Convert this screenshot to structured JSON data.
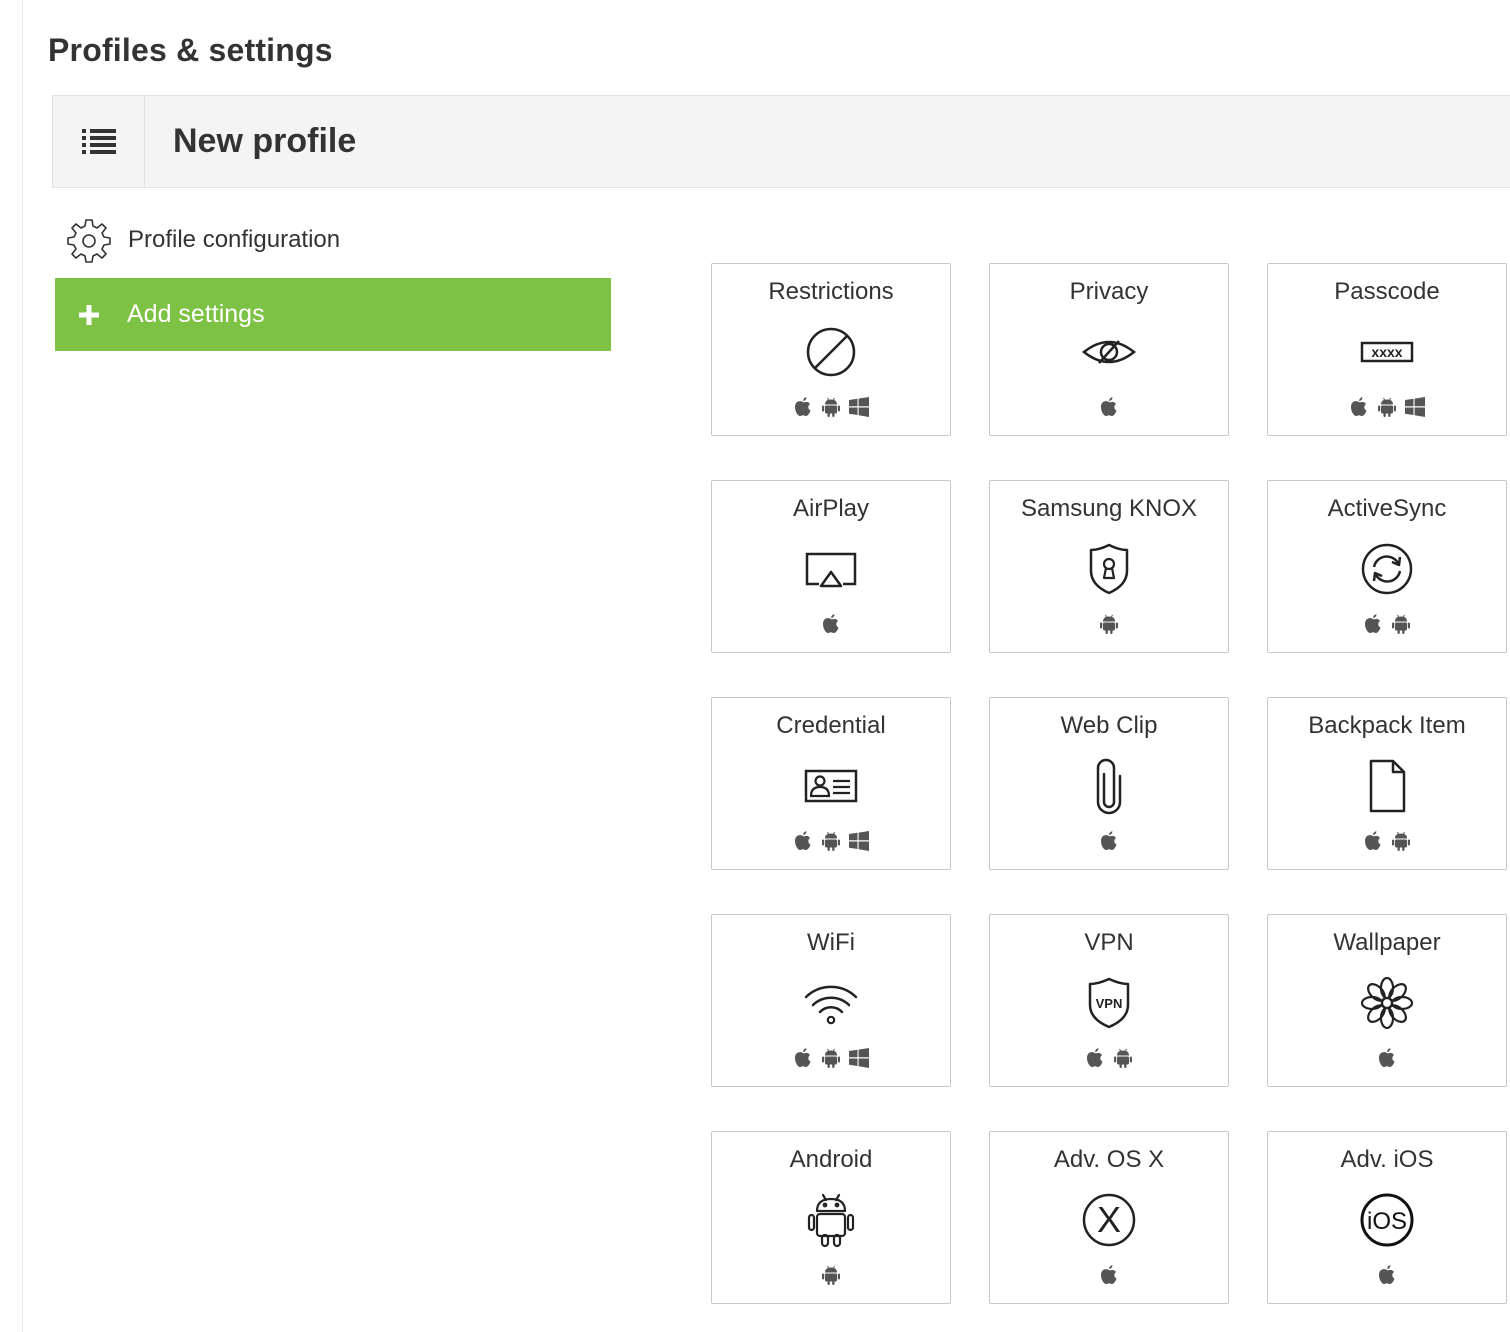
{
  "page": {
    "title": "Profiles & settings",
    "menu_icon": "list-icon"
  },
  "profile": {
    "name": "New profile"
  },
  "sidebar": {
    "config_label": "Profile configuration",
    "config_icon": "gear-icon",
    "add_label": "Add settings",
    "add_icon": "plus-icon",
    "add_color": "#7dc244"
  },
  "tiles": [
    {
      "id": "restrictions",
      "label": "Restrictions",
      "icon": "no-entry-icon",
      "platforms": [
        "apple",
        "android",
        "windows"
      ]
    },
    {
      "id": "privacy",
      "label": "Privacy",
      "icon": "eye-slash-icon",
      "platforms": [
        "apple"
      ]
    },
    {
      "id": "passcode",
      "label": "Passcode",
      "icon": "passcode-icon",
      "icon_text": "xxxx",
      "platforms": [
        "apple",
        "android",
        "windows"
      ]
    },
    {
      "id": "airplay",
      "label": "AirPlay",
      "icon": "airplay-icon",
      "platforms": [
        "apple"
      ]
    },
    {
      "id": "samsung-knox",
      "label": "Samsung KNOX",
      "icon": "shield-keyhole-icon",
      "platforms": [
        "android"
      ]
    },
    {
      "id": "activesync",
      "label": "ActiveSync",
      "icon": "sync-icon",
      "platforms": [
        "apple",
        "android"
      ]
    },
    {
      "id": "credential",
      "label": "Credential",
      "icon": "id-card-icon",
      "platforms": [
        "apple",
        "android",
        "windows"
      ]
    },
    {
      "id": "web-clip",
      "label": "Web Clip",
      "icon": "paperclip-icon",
      "platforms": [
        "apple"
      ]
    },
    {
      "id": "backpack-item",
      "label": "Backpack Item",
      "icon": "document-icon",
      "platforms": [
        "apple",
        "android"
      ]
    },
    {
      "id": "wifi",
      "label": "WiFi",
      "icon": "wifi-icon",
      "platforms": [
        "apple",
        "android",
        "windows"
      ]
    },
    {
      "id": "vpn",
      "label": "VPN",
      "icon": "vpn-shield-icon",
      "icon_text": "VPN",
      "platforms": [
        "apple",
        "android"
      ]
    },
    {
      "id": "wallpaper",
      "label": "Wallpaper",
      "icon": "flower-icon",
      "platforms": [
        "apple"
      ]
    },
    {
      "id": "android",
      "label": "Android",
      "icon": "android-robot-icon",
      "platforms": [
        "android"
      ]
    },
    {
      "id": "adv-os-x",
      "label": "Adv. OS X",
      "icon": "os-x-icon",
      "icon_text": "X",
      "platforms": [
        "apple"
      ]
    },
    {
      "id": "adv-ios",
      "label": "Adv. iOS",
      "icon": "ios-icon",
      "icon_text": "iOS",
      "platforms": [
        "apple"
      ]
    }
  ]
}
